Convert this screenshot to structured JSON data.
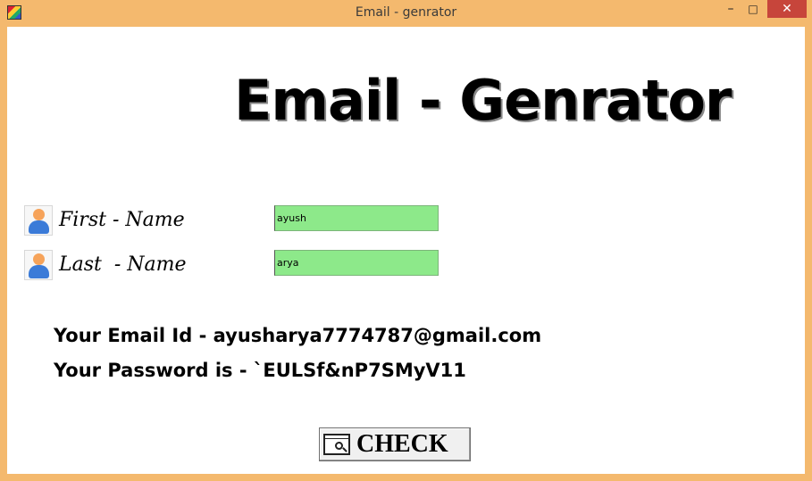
{
  "window": {
    "title": "Email - genrator",
    "icons": {
      "app": "app-icon",
      "minimize": "minimize-icon",
      "maximize": "maximize-icon",
      "close": "close-icon"
    },
    "controls": {
      "minimize": "–",
      "maximize": "□",
      "close": "✕"
    }
  },
  "heading": "Email - Genrator",
  "form": {
    "first_name": {
      "label": "First - Name",
      "value": "ayush",
      "icon": "user-icon"
    },
    "last_name": {
      "label": "Last  - Name",
      "value": "arya",
      "icon": "user-icon"
    },
    "field_color": "#8de98a"
  },
  "results": {
    "email": "Your Email Id - ayusharya7774787@gmail.com",
    "password": "Your Password is - `EULSf&nP7SMyV11"
  },
  "check_button": {
    "label": "CHECK",
    "icon": "magnifier-window-icon"
  }
}
